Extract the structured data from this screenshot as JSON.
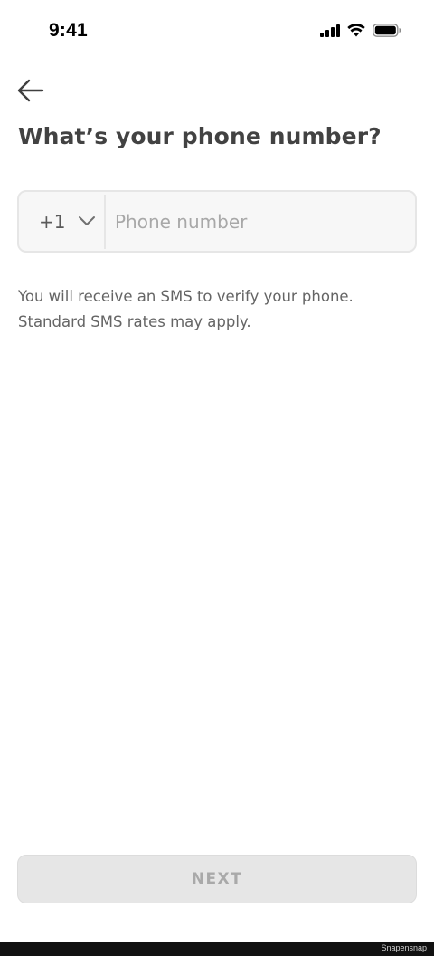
{
  "status_bar": {
    "time": "9:41",
    "icons": [
      "cellular-signal-icon",
      "wifi-icon",
      "battery-icon"
    ]
  },
  "header": {
    "back_icon": "arrow-left-icon",
    "title": "What’s your phone number?"
  },
  "phone_input": {
    "country_code": "+1",
    "country_icon": "chevron-down-icon",
    "value": "",
    "placeholder": "Phone number"
  },
  "helper": {
    "line1": "You will receive an SMS to verify your phone.",
    "line2": "Standard SMS rates may apply."
  },
  "actions": {
    "next_label": "NEXT"
  },
  "footer": {
    "watermark": "Snapensnap"
  },
  "colors": {
    "title": "#424242",
    "input_bg": "#f7f7f7",
    "input_border": "#e6e6e6",
    "placeholder": "#a8a8a8",
    "button_disabled_bg": "#e6e6e6",
    "button_disabled_text": "#a9a9a9"
  }
}
